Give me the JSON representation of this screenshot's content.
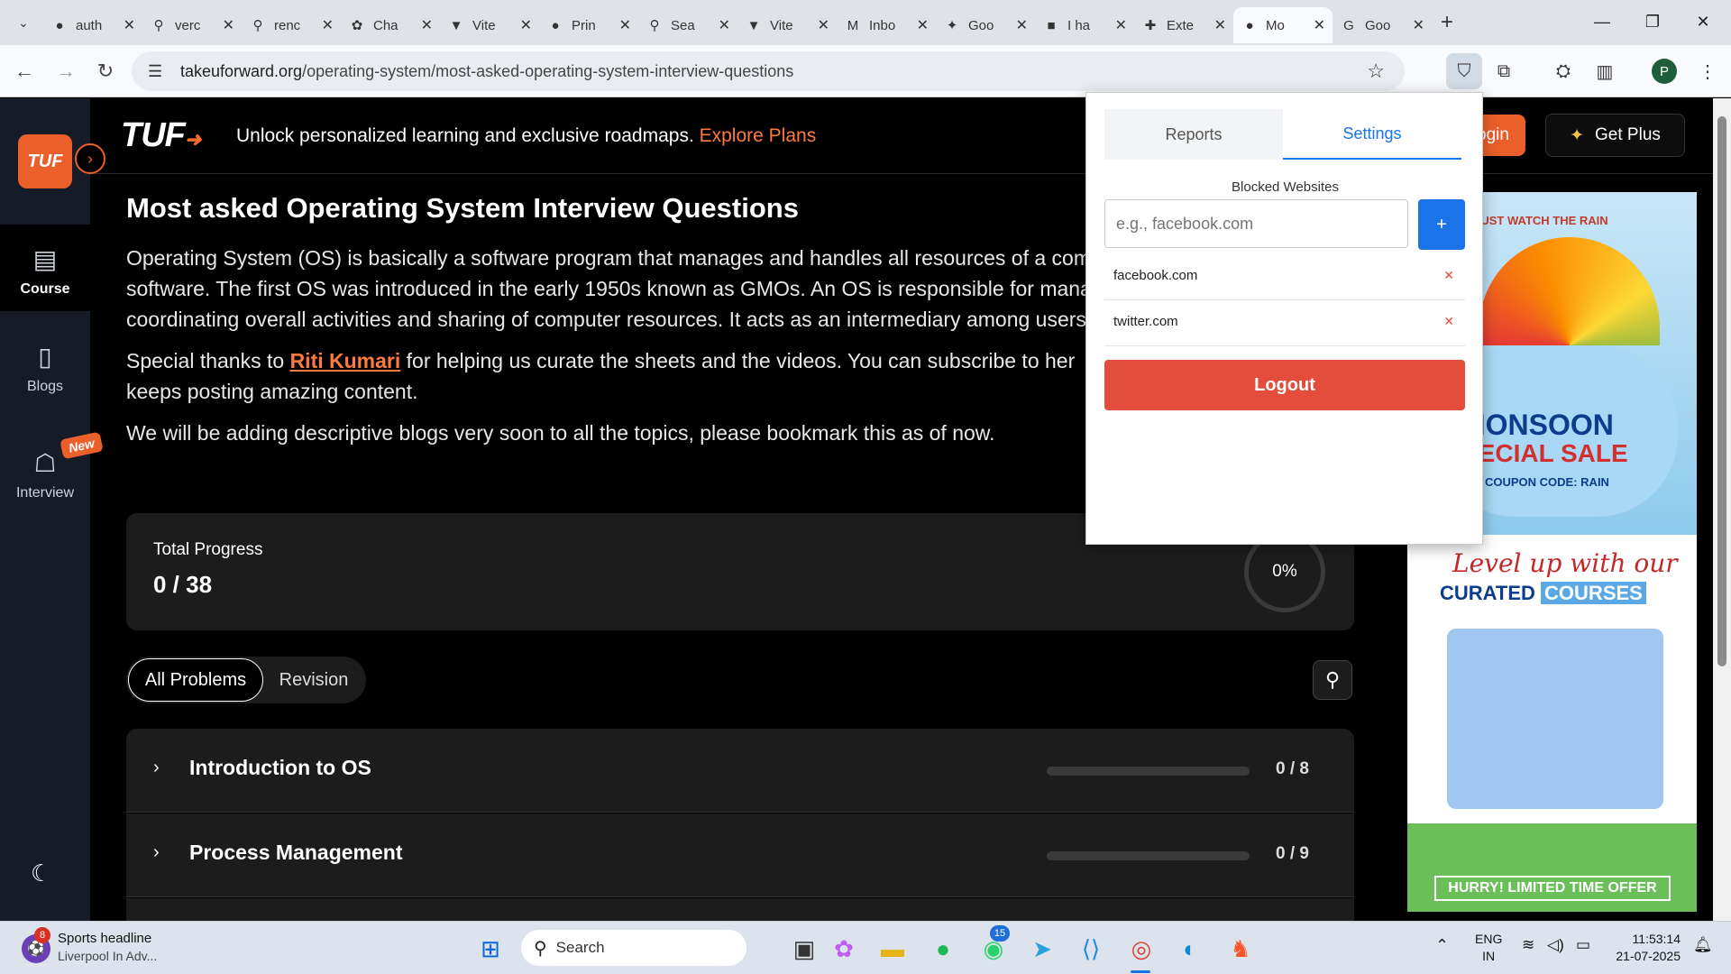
{
  "browser": {
    "tabs": [
      {
        "label": "auth",
        "icon": "github-icon",
        "glyph": "●"
      },
      {
        "label": "verc",
        "icon": "search-icon",
        "glyph": "⚲"
      },
      {
        "label": "renc",
        "icon": "search-icon",
        "glyph": "⚲"
      },
      {
        "label": "Cha",
        "icon": "chatgpt-icon",
        "glyph": "✿"
      },
      {
        "label": "Vite",
        "icon": "vite-icon",
        "glyph": "▼"
      },
      {
        "label": "Prin",
        "icon": "github-icon",
        "glyph": "●"
      },
      {
        "label": "Sea",
        "icon": "search-icon",
        "glyph": "⚲"
      },
      {
        "label": "Vite",
        "icon": "vite-icon",
        "glyph": "▼"
      },
      {
        "label": "Inbo",
        "icon": "gmail-icon",
        "glyph": "M"
      },
      {
        "label": "Goo",
        "icon": "gemini-icon",
        "glyph": "✦"
      },
      {
        "label": "I ha",
        "icon": "notion-icon",
        "glyph": "■"
      },
      {
        "label": "Exte",
        "icon": "puzzle-icon",
        "glyph": "✚"
      },
      {
        "label": "Mo",
        "icon": "tuf-icon",
        "glyph": "●",
        "active": true
      },
      {
        "label": "Goo",
        "icon": "google-icon",
        "glyph": "G"
      }
    ],
    "close_glyph": "✕",
    "new_tab": "+",
    "url_domain": "takeuforward.org",
    "url_path": "/operating-system/most-asked-operating-system-interview-questions"
  },
  "site": {
    "logo": "TUF",
    "promo_text": "Unlock personalized learning and exclusive roadmaps. ",
    "promo_link": "Explore Plans",
    "login_label": "ogin",
    "get_plus_label": "Get Plus",
    "nav": [
      {
        "label": "Course",
        "glyph": "▤"
      },
      {
        "label": "Blogs",
        "glyph": "▯"
      },
      {
        "label": "Interview",
        "glyph": "☖"
      }
    ],
    "new_badge": "New",
    "title": "Most asked Operating System Interview Questions",
    "para1": [
      "Operating System (OS) is basically a software program that manages and handles all resources of a comp",
      "software. The first OS was introduced in the early 1950s known as GMOs. An OS is responsible for manag",
      "coordinating overall activities and sharing of computer resources. It acts as an intermediary among users"
    ],
    "para2_prefix": "Special thanks to ",
    "para2_link": "Riti Kumari",
    "para2_suffix": " for helping us curate the sheets and the videos. You can subscribe to her",
    "para2_line2": "keeps posting amazing content.",
    "para3": "We will be adding descriptive blogs very soon to all the topics, please bookmark this as of now.",
    "progress": {
      "label": "Total Progress",
      "value": "0 / 38",
      "percent_text": "0%",
      "percent": 0
    },
    "filters": {
      "all": "All Problems",
      "revision": "Revision"
    },
    "sections": [
      {
        "name": "Introduction to OS",
        "count": "0 / 8",
        "progress": 0
      },
      {
        "name": "Process Management",
        "count": "0 / 9",
        "progress": 0
      }
    ],
    "ad": {
      "top": "ON'T JUST WATCH THE RAIN",
      "line1": "MONSOON",
      "line2": "PECIAL SALE",
      "coupon": "COUPON CODE: RAIN",
      "levelup": "Level up with our",
      "curated": "CURATED",
      "courses": "COURSES",
      "cta": "HURRY! LIMITED TIME OFFER"
    }
  },
  "popup": {
    "tabs": [
      "Reports",
      "Settings"
    ],
    "active_tab": "Settings",
    "section_title": "Blocked Websites",
    "input_placeholder": "e.g., facebook.com",
    "add_label": "+",
    "blocked": [
      "facebook.com",
      "twitter.com"
    ],
    "remove_glyph": "✕",
    "logout_label": "Logout",
    "accent": "#1a73e8",
    "danger": "#e44c3c"
  },
  "taskbar": {
    "news_title": "Sports headline",
    "news_sub": "Liverpool In Adv...",
    "news_badge": "8",
    "search_label": "Search",
    "whatsapp_badge": "15",
    "lang1": "ENG",
    "lang2": "IN",
    "time": "11:53:14",
    "date": "21-07-2025"
  },
  "colors": {
    "brand": "#ea5f2a",
    "link": "#ff7a3d"
  }
}
